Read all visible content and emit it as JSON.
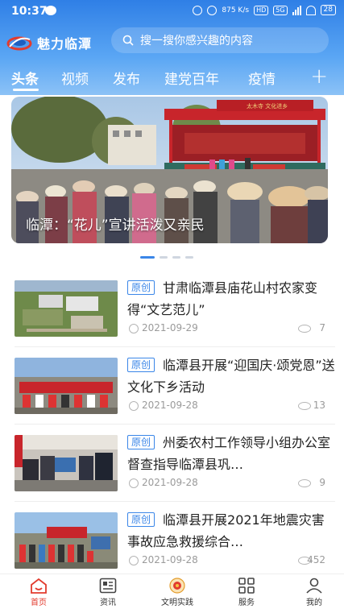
{
  "status_bar": {
    "time": "10:37",
    "net_speed": "875 K/s",
    "hd_badge": "HD",
    "signal_label": "5G",
    "battery": "28"
  },
  "app": {
    "name": "魅力临潭",
    "search_placeholder": "搜一搜你感兴趣的内容"
  },
  "tabs": [
    {
      "label": "头条",
      "active": true
    },
    {
      "label": "视频",
      "active": false
    },
    {
      "label": "发布",
      "active": false
    },
    {
      "label": "建党百年",
      "active": false
    },
    {
      "label": "疫情",
      "active": false
    }
  ],
  "tab_add_symbol": "+",
  "banner": {
    "caption": "临潭：“花儿”宣讲活泼又亲民",
    "stage_sign": "太木寺 文化进乡"
  },
  "news": [
    {
      "badge": "原创",
      "title": "甘肃临潭县庙花山村农家变得“文艺范儿”",
      "date": "2021-09-29",
      "views": "7"
    },
    {
      "badge": "原创",
      "title": "临潭县开展“迎国庆·颂党恩”送文化下乡活动",
      "date": "2021-09-28",
      "views": "13"
    },
    {
      "badge": "原创",
      "title": "州委农村工作领导小组办公室督查指导临潭县巩…",
      "date": "2021-09-28",
      "views": "9"
    },
    {
      "badge": "原创",
      "title": "临潭县开展2021年地震灾害事故应急救援综合…",
      "date": "2021-09-28",
      "views": "452"
    }
  ],
  "bottom_nav": [
    {
      "label": "首页",
      "icon": "home-icon",
      "active": true
    },
    {
      "label": "资讯",
      "icon": "news-icon",
      "active": false
    },
    {
      "label": "文明实践",
      "icon": "civilization-icon",
      "active": false
    },
    {
      "label": "服务",
      "icon": "grid-icon",
      "active": false
    },
    {
      "label": "我的",
      "icon": "user-icon",
      "active": false
    }
  ],
  "colors": {
    "header_blue": "#2f7fe6",
    "accent_blue": "#3a86e8",
    "active_red": "#e23b2e"
  }
}
